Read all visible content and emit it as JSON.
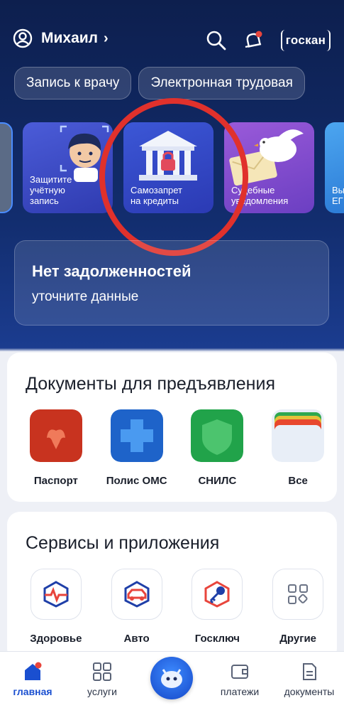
{
  "header": {
    "user_name": "Михаил",
    "user_chevron": "›",
    "goskan_label": "госкан"
  },
  "chips": [
    "Запись к врачу",
    "Электронная трудовая"
  ],
  "stories": [
    {
      "label": "",
      "color": "#5b6b86"
    },
    {
      "label": "Защитите\nучётную\nзапись",
      "color": "#3f4fd0"
    },
    {
      "label": "Самозапрет\nна кредиты",
      "color": "#3448c9"
    },
    {
      "label": "Судебные\nуведомления",
      "color": "#8350d0"
    },
    {
      "label": "Вы\nЕГ",
      "color": "#3a90e6"
    }
  ],
  "debt": {
    "title": "Нет задолженностей",
    "subtitle": "уточните данные"
  },
  "documents": {
    "title": "Документы для предъявления",
    "items": [
      {
        "label": "Паспорт",
        "icon": "passport-icon",
        "color": "#c8331f"
      },
      {
        "label": "Полис ОМС",
        "icon": "oms-icon",
        "color": "#1e63c9"
      },
      {
        "label": "СНИЛС",
        "icon": "snils-icon",
        "color": "#21a34a"
      },
      {
        "label": "Все",
        "icon": "all-docs-icon",
        "color": "#e8eef7"
      }
    ]
  },
  "services": {
    "title": "Сервисы и приложения",
    "items": [
      {
        "label": "Здоровье",
        "icon": "health-icon"
      },
      {
        "label": "Авто",
        "icon": "car-icon"
      },
      {
        "label": "Госключ",
        "icon": "key-icon"
      },
      {
        "label": "Другие",
        "icon": "grid-icon"
      }
    ]
  },
  "nav": [
    {
      "label": "главная",
      "icon": "home-icon",
      "active": true
    },
    {
      "label": "услуги",
      "icon": "services-icon"
    },
    {
      "label": "",
      "icon": "robot-assistant-icon"
    },
    {
      "label": "платежи",
      "icon": "wallet-icon"
    },
    {
      "label": "документы",
      "icon": "document-icon"
    }
  ],
  "colors": {
    "accent": "#1a4fd0",
    "notification": "#e8453c",
    "annotation": "#e0312c"
  }
}
